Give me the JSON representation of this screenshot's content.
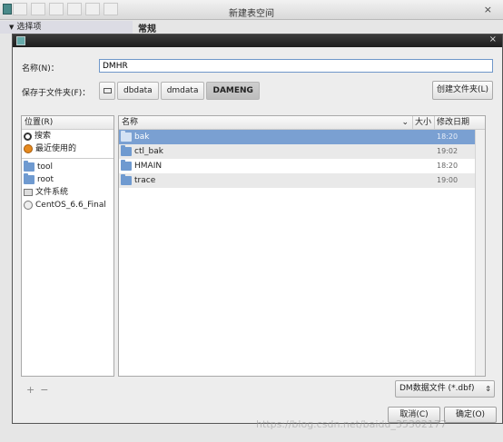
{
  "background_window": {
    "title": "新建表空间",
    "close_glyph": "×",
    "left_section": "选择项",
    "right_section": "常规"
  },
  "dialog": {
    "name_label": "名称(N)：",
    "name_value": "DMHR",
    "save_in_label": "保存于文件夹(F)：",
    "path_segments": [
      "dbdata",
      "dmdata",
      "DAMENG"
    ],
    "create_folder_button": "创建文件夹(L)",
    "places_header": "位置(R)",
    "places": [
      {
        "label": "搜索",
        "icon": "search-icon"
      },
      {
        "label": "最近使用的",
        "icon": "recent-icon"
      },
      {
        "label": "tool",
        "icon": "folder-icon"
      },
      {
        "label": "root",
        "icon": "folder-icon"
      },
      {
        "label": "文件系统",
        "icon": "filesystem-icon"
      },
      {
        "label": "CentOS_6.6_Final",
        "icon": "disc-icon"
      }
    ],
    "places_add": "+",
    "places_remove": "−",
    "columns": {
      "name": "名称",
      "size": "大小",
      "modified": "修改日期"
    },
    "files": [
      {
        "name": "bak",
        "size": "",
        "modified": "18:20"
      },
      {
        "name": "ctl_bak",
        "size": "",
        "modified": "19:02"
      },
      {
        "name": "HMAIN",
        "size": "",
        "modified": "18:20"
      },
      {
        "name": "trace",
        "size": "",
        "modified": "19:00"
      }
    ],
    "filter_value": "DM数据文件 (*.dbf)",
    "cancel_button": "取消(C)",
    "ok_button": "确定(O)"
  },
  "watermark": "https://blog.csdn.net/baidu_35302177"
}
